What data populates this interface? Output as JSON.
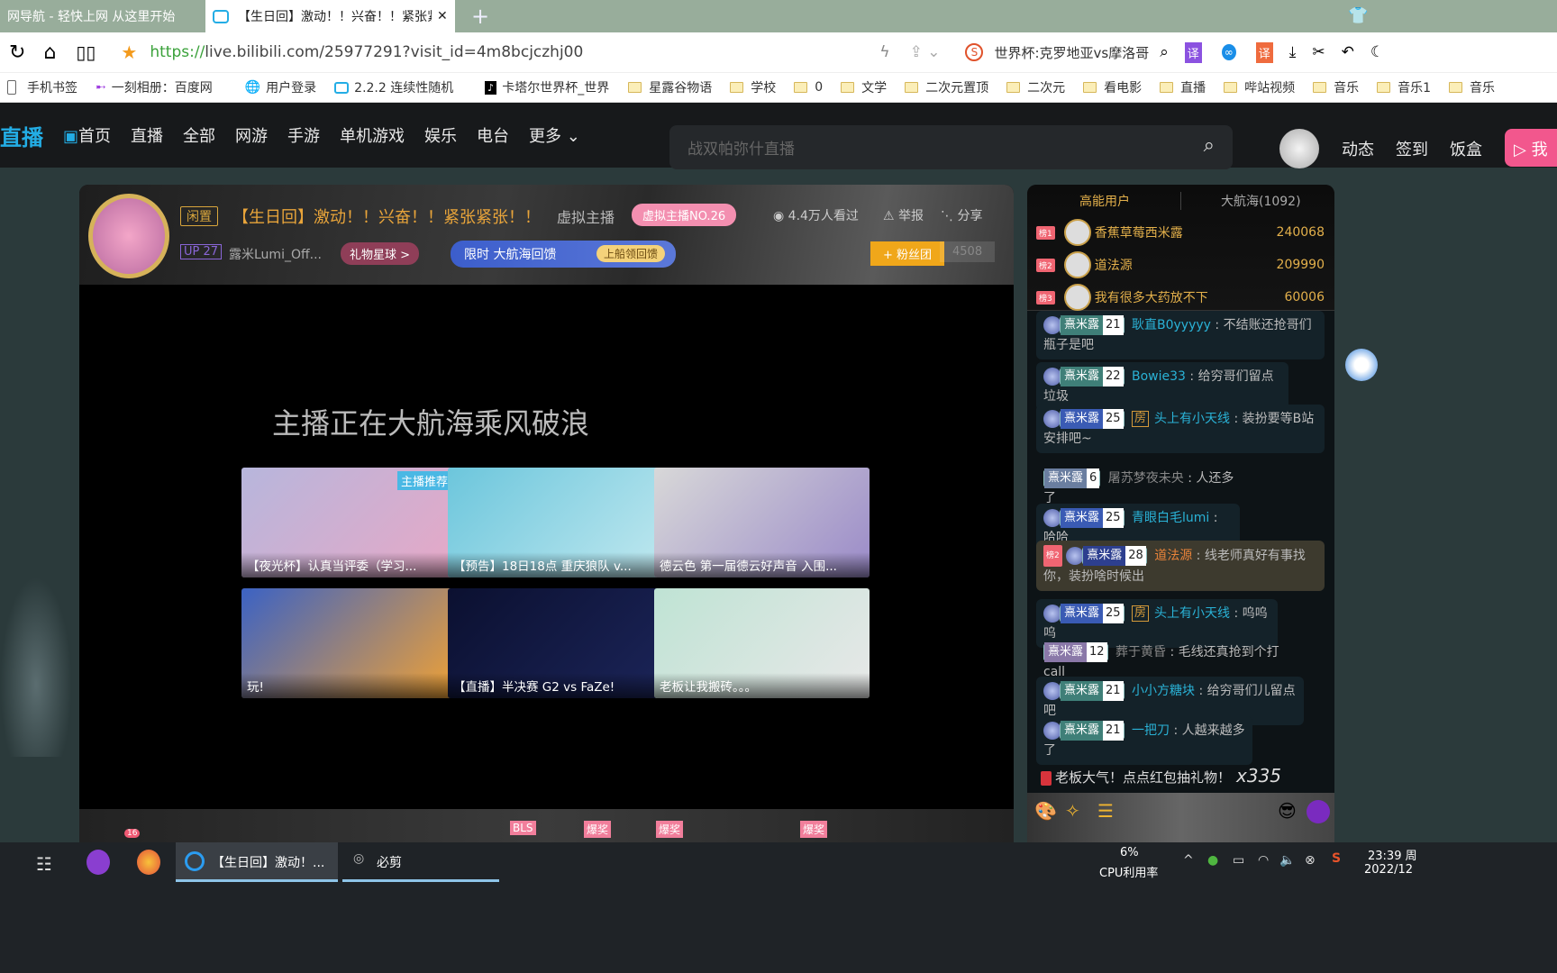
{
  "browser": {
    "tabs": [
      {
        "label": "网导航 - 轻快上网 从这里开始"
      },
      {
        "label": "【生日回】激动！！兴奋！！紧张紧"
      }
    ],
    "new_tab": "+",
    "url_scheme": "https://",
    "url_rest": "live.bilibili.com/25977291?visit_id=4m8bcjczhj00",
    "search_suggestion": "世界杯:克罗地亚vs摩洛哥",
    "bookmarks": [
      "手机书签",
      "一刻相册：百度网",
      "用户登录",
      "2.2.2 连续性随机",
      "卡塔尔世界杯_世界",
      "星露谷物语",
      "学校",
      "0",
      "文学",
      "二次元置顶",
      "二次元",
      "看电影",
      "直播",
      "哔站视频",
      "音乐",
      "音乐1",
      "音乐"
    ]
  },
  "site_nav": {
    "logo": "直播",
    "items": [
      "首页",
      "直播",
      "全部",
      "网游",
      "手游",
      "单机游戏",
      "娱乐",
      "电台",
      "更多"
    ],
    "search_placeholder": "战双帕弥什直播",
    "right_items": [
      "动态",
      "签到",
      "饭盒"
    ],
    "live_button": "我"
  },
  "room": {
    "status": "闲置",
    "title": "【生日回】激动！！兴奋！！紧张紧张！！",
    "category": "虚拟主播",
    "rank_badge": "虚拟主播NO.26",
    "views": "4.4万人看过",
    "report": "举报",
    "share": "分享",
    "up_level": "UP 27",
    "streamer": "露米Lumi_Off...",
    "gift_planet": "礼物星球 >",
    "banner_text": "限时 大航海回馈",
    "banner_button": "上船领回馈",
    "fan_button": "+ 粉丝团",
    "fan_count": "4508"
  },
  "player": {
    "message": "主播正在大航海乘风破浪",
    "recommend_tag": "主播推荐",
    "cards": [
      {
        "caption": "【夜光杯】认真当评委（学习...",
        "colors": [
          "#b7b6dc",
          "#e7a8c6"
        ]
      },
      {
        "caption": "【预告】18日18点 重庆狼队 v...",
        "colors": [
          "#6cc6dc",
          "#c0e8ef"
        ]
      },
      {
        "caption": "德云色 第一届德云好声音 入围...",
        "colors": [
          "#d8d8d8",
          "#9a8ac8"
        ]
      },
      {
        "caption": "玩!",
        "colors": [
          "#3b62c4",
          "#f2a233"
        ]
      },
      {
        "caption": "【直播】半决赛 G2 vs FaZe!",
        "colors": [
          "#0b1030",
          "#1b2458"
        ]
      },
      {
        "caption": "老板让我搬砖。。。",
        "colors": [
          "#bfe3d4",
          "#e8e8e8"
        ]
      }
    ],
    "gift_badges": [
      "16",
      "BLS",
      "爆奖",
      "爆奖",
      "爆奖"
    ]
  },
  "chat": {
    "tabs": [
      "高能用户",
      "大航海(1092)"
    ],
    "top_users": [
      {
        "rank": "榜1",
        "name": "香蕉草莓西米露",
        "score": "240068"
      },
      {
        "rank": "榜2",
        "name": "道法源",
        "score": "209990"
      },
      {
        "rank": "榜3",
        "name": "我有很多大药放不下",
        "score": "60006"
      }
    ],
    "medal_name": "熹米露",
    "room_tag": "房",
    "messages": [
      {
        "level": "21",
        "user": "耿直B0yyyyy",
        "text": "不结账还抢哥们瓶子是吧"
      },
      {
        "level": "22",
        "user": "Bowie33",
        "text": "给穷哥们留点垃圾"
      },
      {
        "level": "25",
        "user": "头上有小天线",
        "text": "装扮要等B站安排吧~",
        "room": true
      },
      {
        "level": "6",
        "user": "屠苏梦夜未央",
        "text": "人还多了"
      },
      {
        "level": "25",
        "user": "青眼白毛lumi",
        "text": "哈哈"
      },
      {
        "level": "28",
        "user": "道法源",
        "text": "线老师真好有事找你，装扮啥时候出",
        "rank": "榜2"
      },
      {
        "level": "25",
        "user": "头上有小天线",
        "text": "呜呜呜",
        "room": true
      },
      {
        "level": "12",
        "user": "葬于黄昏",
        "text": "毛线还真抢到个打call"
      },
      {
        "level": "21",
        "user": "小小方糖块",
        "text": "给穷哥们儿留点吧"
      },
      {
        "level": "21",
        "user": "一把刀",
        "text": "人越来越多了"
      }
    ],
    "red_packet": "老板大气！点点红包抽礼物！",
    "red_packet_count": "x335"
  },
  "taskbar": {
    "apps": [
      {
        "label": "【生日回】激动！..."
      },
      {
        "label": "必剪"
      }
    ],
    "cpu_value": "6%",
    "cpu_label": "CPU利用率",
    "time": "23:39 周",
    "date": "2022/12"
  }
}
